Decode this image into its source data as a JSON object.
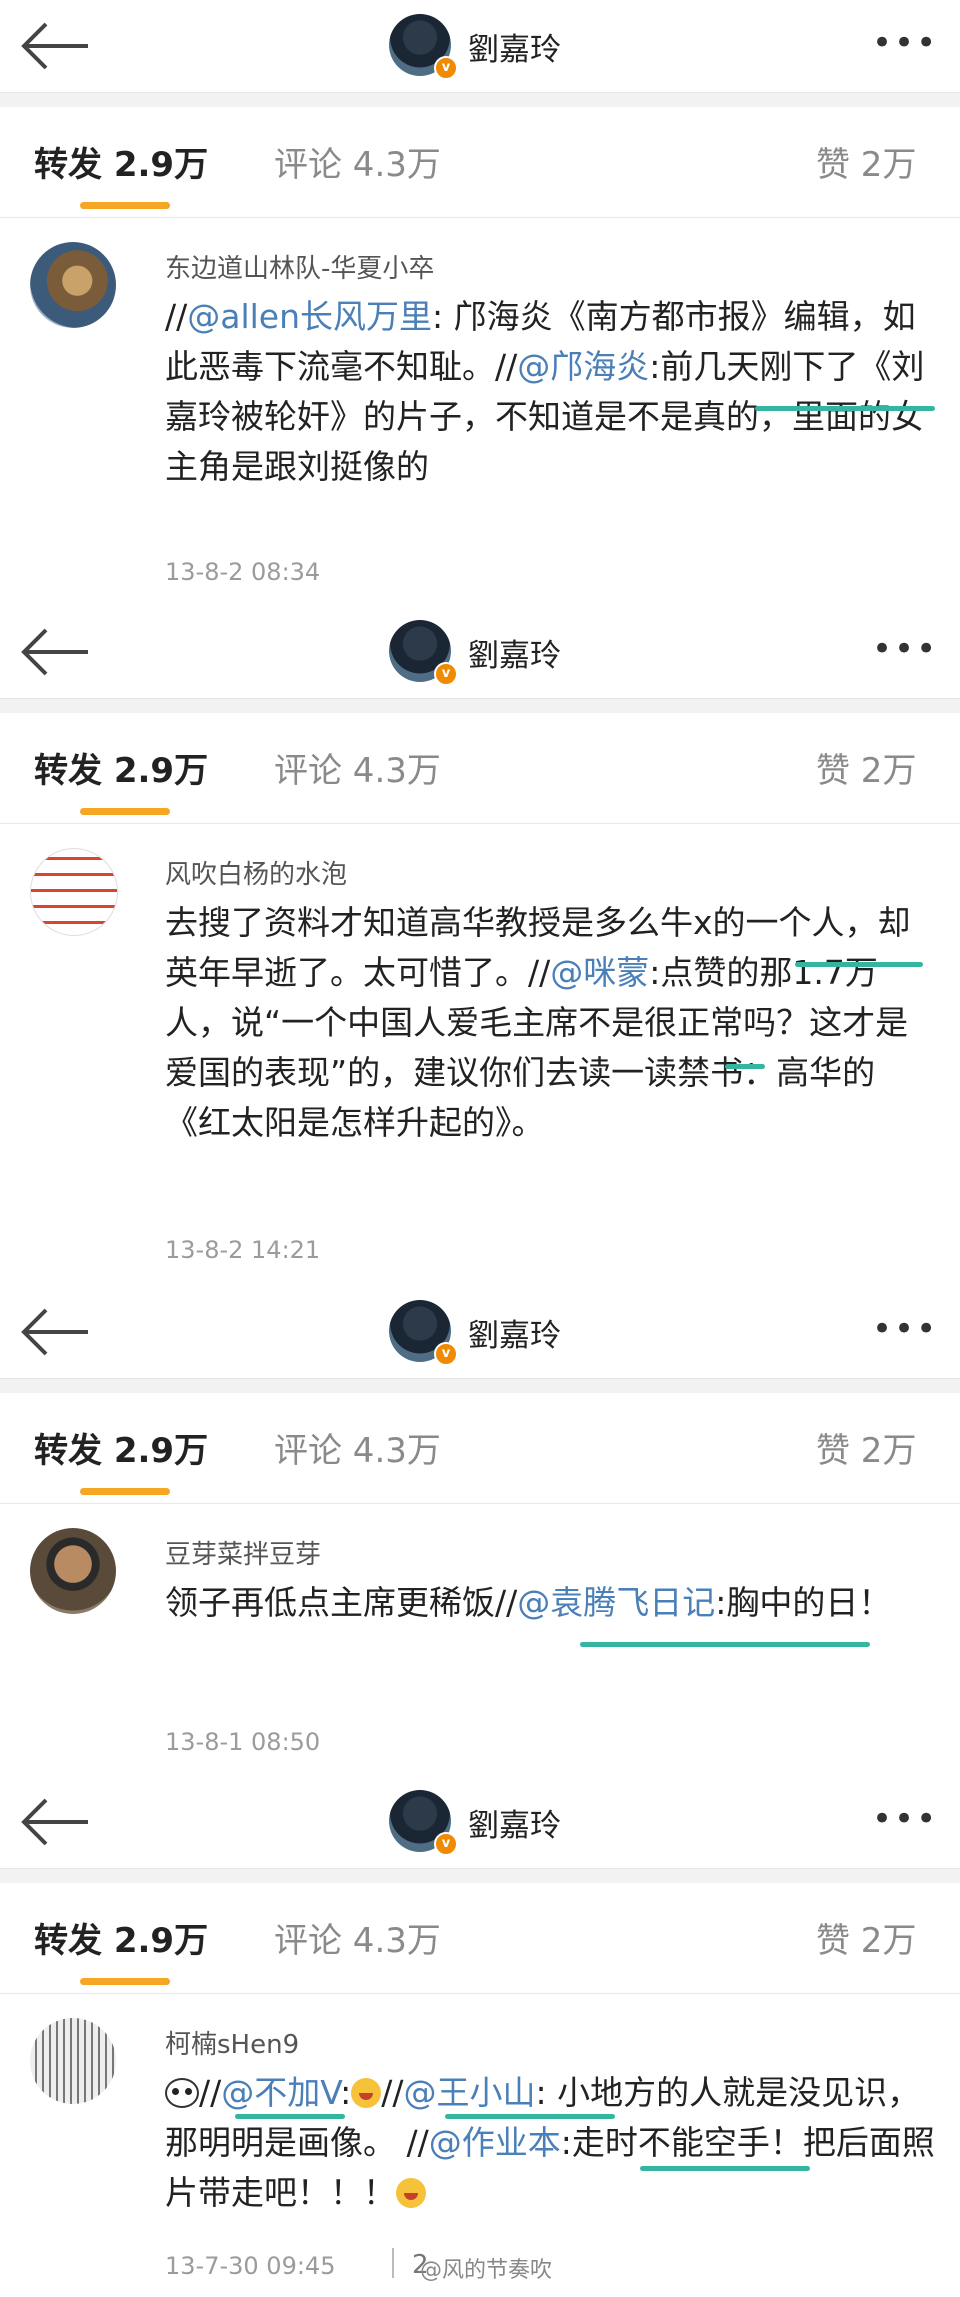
{
  "profile_name": "劉嘉玲",
  "tabs": {
    "repost": "转发 2.9万",
    "comment": "评论 4.3万",
    "like": "赞 2万"
  },
  "posts": [
    {
      "user": "东边道山林队-华夏小卒",
      "segments": [
        {
          "t": "//",
          "m": false
        },
        {
          "t": "@allen长风万里",
          "m": true
        },
        {
          "t": ": 邝海炎《南方都市报》编辑，如此恶毒下流毫不知耻。//",
          "m": false
        },
        {
          "t": "@邝海炎",
          "m": true
        },
        {
          "t": ":前几天刚下了《刘嘉玲被轮奸》的片子，不知道是不是真的，里面的女主角是跟刘挺像的",
          "m": false
        }
      ],
      "time": "13-8-2 08:34"
    },
    {
      "user": "风吹白杨的水泡",
      "segments": [
        {
          "t": "去搜了资料才知道高华教授是多么牛x的一个人，却英年早逝了。太可惜了。//",
          "m": false
        },
        {
          "t": "@咪蒙",
          "m": true
        },
        {
          "t": ":点赞的那1.7万人，说“一个中国人爱毛主席不是很正常吗？这才是爱国的表现”的，建议你们去读一读禁书：高华的《红太阳是怎样升起的》。",
          "m": false
        }
      ],
      "time": "13-8-2 14:21"
    },
    {
      "user": "豆芽菜拌豆芽",
      "segments": [
        {
          "t": "领子再低点主席更稀饭//",
          "m": false
        },
        {
          "t": "@袁腾飞日记",
          "m": true
        },
        {
          "t": ":胸中的日！",
          "m": false
        }
      ],
      "time": "13-8-1 08:50"
    },
    {
      "user": "柯楠sHen9",
      "segments": [
        {
          "t": "//",
          "m": false,
          "pre": "panda"
        },
        {
          "t": "@不加V",
          "m": true
        },
        {
          "t": ":",
          "m": false,
          "post": "emoji"
        },
        {
          "t": "//",
          "m": false
        },
        {
          "t": "@王小山",
          "m": true
        },
        {
          "t": ": 小地方的人就是没见识，那明明是画像。 //",
          "m": false
        },
        {
          "t": "@作业本",
          "m": true
        },
        {
          "t": ":走时不能空手！把后面照片带走吧！！！",
          "m": false,
          "post": "emoji"
        }
      ],
      "time": "13-7-30 09:45",
      "count": "2",
      "watermark": "@风的节奏吹"
    }
  ]
}
